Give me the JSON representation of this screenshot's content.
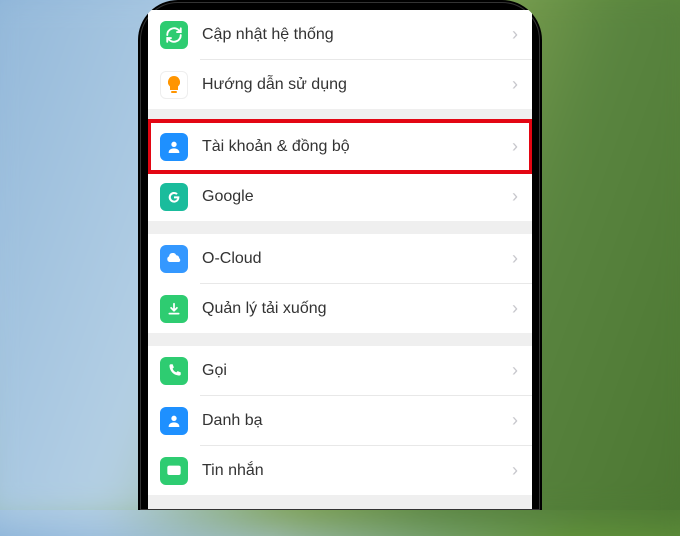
{
  "settings": {
    "group1": {
      "system_update": {
        "label": "Cập nhật hệ thống",
        "icon": "refresh",
        "color": "#2ecc71"
      },
      "user_guide": {
        "label": "Hướng dẫn sử dụng",
        "icon": "bulb",
        "color": "#ff9500"
      }
    },
    "group2": {
      "accounts_sync": {
        "label": "Tài khoản & đồng bộ",
        "icon": "person",
        "color": "#1e90ff",
        "highlighted": true
      },
      "google": {
        "label": "Google",
        "icon": "google",
        "color": "#1abc9c"
      }
    },
    "group3": {
      "ocloud": {
        "label": "O-Cloud",
        "icon": "cloud",
        "color": "#3498ff"
      },
      "downloads": {
        "label": "Quản lý tải xuống",
        "icon": "download",
        "color": "#2ecc71"
      }
    },
    "group4": {
      "call": {
        "label": "Gọi",
        "icon": "phone",
        "color": "#2ecc71"
      },
      "contacts": {
        "label": "Danh bạ",
        "icon": "contact",
        "color": "#1e90ff"
      },
      "messages": {
        "label": "Tin nhắn",
        "icon": "message",
        "color": "#2ecc71"
      }
    }
  },
  "highlight": {
    "target": "accounts_sync"
  }
}
